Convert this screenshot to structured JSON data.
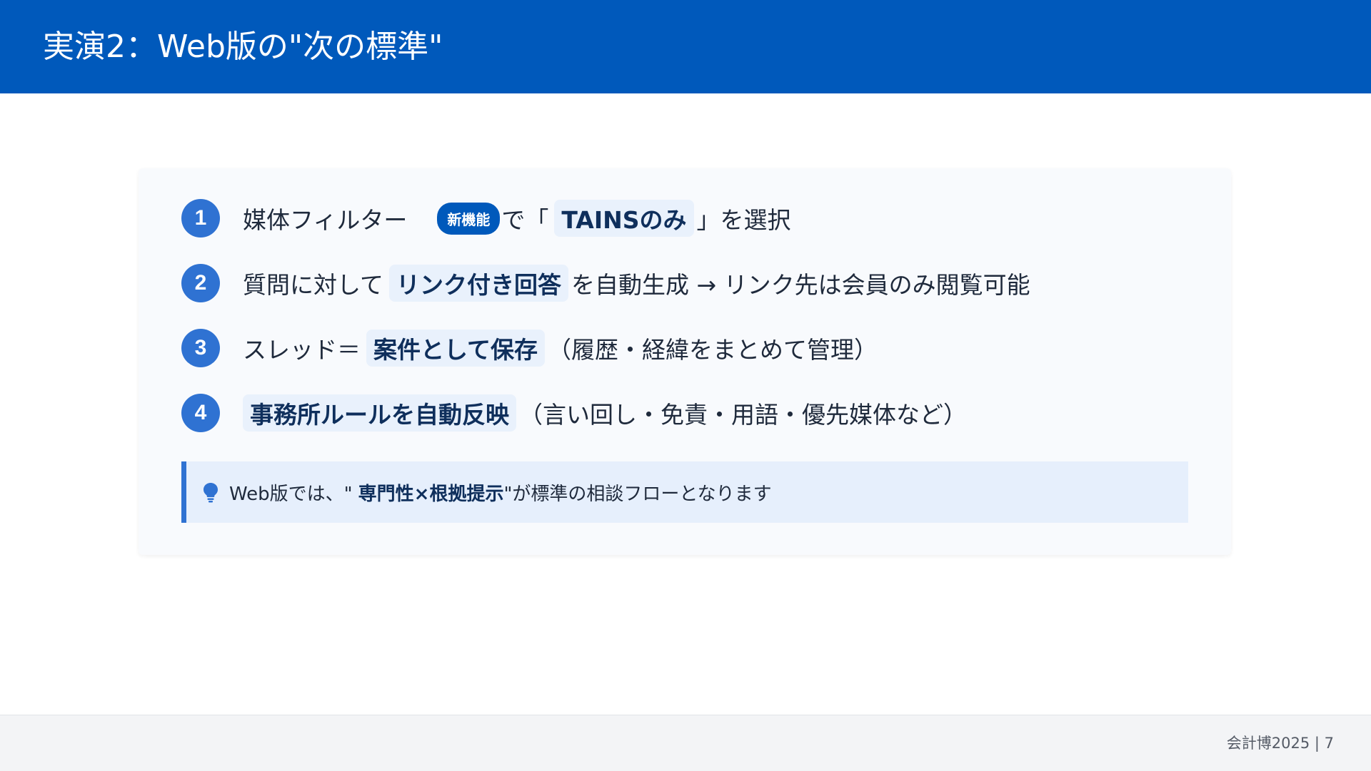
{
  "header": {
    "title": "実演2：Web版の\"次の標準\""
  },
  "items": [
    {
      "num": "1",
      "pre": "媒体フィルター",
      "badge": "新機能",
      "mid": "で「",
      "highlight": "TAINSのみ",
      "post": "」を選択"
    },
    {
      "num": "2",
      "pre": "質問に対して",
      "highlight": "リンク付き回答",
      "post": "を自動生成 → リンク先は会員のみ閲覧可能"
    },
    {
      "num": "3",
      "pre": "スレッド＝",
      "highlight": "案件として保存",
      "post": "（履歴・経緯をまとめて管理）"
    },
    {
      "num": "4",
      "highlight": "事務所ルールを自動反映",
      "post": "（言い回し・免責・用語・優先媒体など）"
    }
  ],
  "note": {
    "pre": "Web版では、\"",
    "bold": "専門性×根拠提示",
    "post": "\"が標準の相談フローとなります",
    "icon": "lightbulb-icon"
  },
  "footer": {
    "page_label": "会計博2025 | 7"
  },
  "colors": {
    "header": "#0059bb",
    "accent": "#2f72d2",
    "highlight_bg": "#e9f1fc",
    "note_bg": "#e6effc"
  }
}
